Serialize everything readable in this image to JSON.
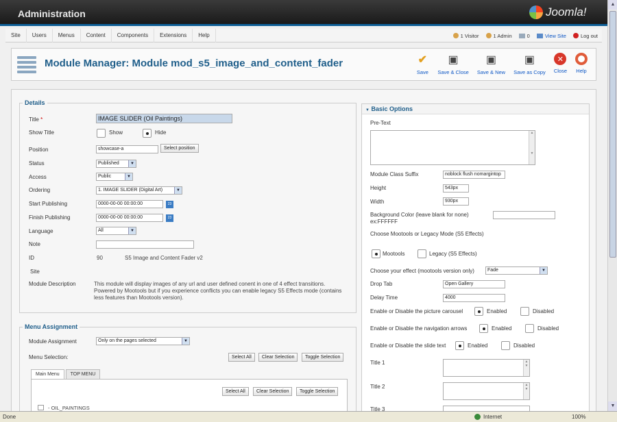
{
  "window": {
    "header_title": "Administration",
    "logo_text": "Joomla!"
  },
  "menubar": {
    "items": [
      "Site",
      "Users",
      "Menus",
      "Content",
      "Components",
      "Extensions",
      "Help"
    ],
    "status": {
      "visitors": "1 Visitor",
      "admins": "1 Admin",
      "messages": "0",
      "view_site": "View Site",
      "logout": "Log out"
    }
  },
  "toolbar": {
    "title": "Module Manager: Module mod_s5_image_and_content_fader",
    "save": "Save",
    "save_close": "Save & Close",
    "save_new": "Save & New",
    "save_copy": "Save as Copy",
    "close": "Close",
    "help": "Help"
  },
  "details": {
    "legend": "Details",
    "title_label": "Title",
    "title_value": "IMAGE SLIDER (Oil Paintings)",
    "show_title_label": "Show Title",
    "show_label": "Show",
    "hide_label": "Hide",
    "position_label": "Position",
    "position_value": "showcase-a",
    "select_position": "Select position",
    "status_label": "Status",
    "status_value": "Published",
    "access_label": "Access",
    "access_value": "Public",
    "ordering_label": "Ordering",
    "ordering_value": "1. IMAGE SLIDER (Digital Art)",
    "start_label": "Start Publishing",
    "start_value": "0000-00-00 00:00:00",
    "finish_label": "Finish Publishing",
    "finish_value": "0000-00-00 00:00:00",
    "calendar_icon_text": "23",
    "language_label": "Language",
    "language_value": "All",
    "note_label": "Note",
    "note_value": "",
    "id_label": "ID",
    "id_value": "90",
    "id_module": "S5 Image and Content Fader v2",
    "site_label": "Site",
    "desc_label": "Module Description",
    "desc_text": "This module will display images of any url and user defined conent in one of 4 effect transitions. Powered by Mootools but if you experience conflicts you can enable legacy S5 Effects mode (contains less features than Mootools version)."
  },
  "menu_assignment": {
    "legend": "Menu Assignment",
    "assignment_label": "Module Assignment",
    "assignment_value": "Only on the pages selected",
    "selection_label": "Menu Selection:",
    "select_all": "Select All",
    "clear_selection": "Clear Selection",
    "toggle_selection": "Toggle Selection",
    "tabs": [
      "Main Menu",
      "TOP MENU"
    ],
    "first_item": "- OIL_PAINTINGS"
  },
  "basic_options": {
    "header": "Basic Options",
    "pretext_label": "Pre-Text",
    "suffix_label": "Module Class Suffix",
    "suffix_value": "noblock flush nomargintop",
    "height_label": "Height",
    "height_value": "543px",
    "width_label": "Width",
    "width_value": "930px",
    "bg_label": "Background Color (leave blank for none) ex:FFFFFF",
    "bg_value": "",
    "mode_label": "Choose Mootools or Legacy Mode (S5 Effects)",
    "mootools_label": "Mootools",
    "legacy_label": "Legacy (S5 Effects)",
    "effect_label": "Choose your effect (mootools version only)",
    "effect_value": "Fade",
    "droptab_label": "Drop Tab",
    "droptab_value": "Open Gallery",
    "delay_label": "Delay Time",
    "delay_value": "4000",
    "carousel_label": "Enable or Disable the picture carousel",
    "arrows_label": "Enable or Disable the navigation arrows",
    "slidetext_label": "Enable or Disable the slide text",
    "enabled_label": "Enabled",
    "disabled_label": "Disabled",
    "title1_label": "Title 1",
    "title2_label": "Title 2",
    "title3_label": "Title 3"
  },
  "statusbar": {
    "left": "Done",
    "zone": "Internet",
    "zoom": "100%"
  }
}
